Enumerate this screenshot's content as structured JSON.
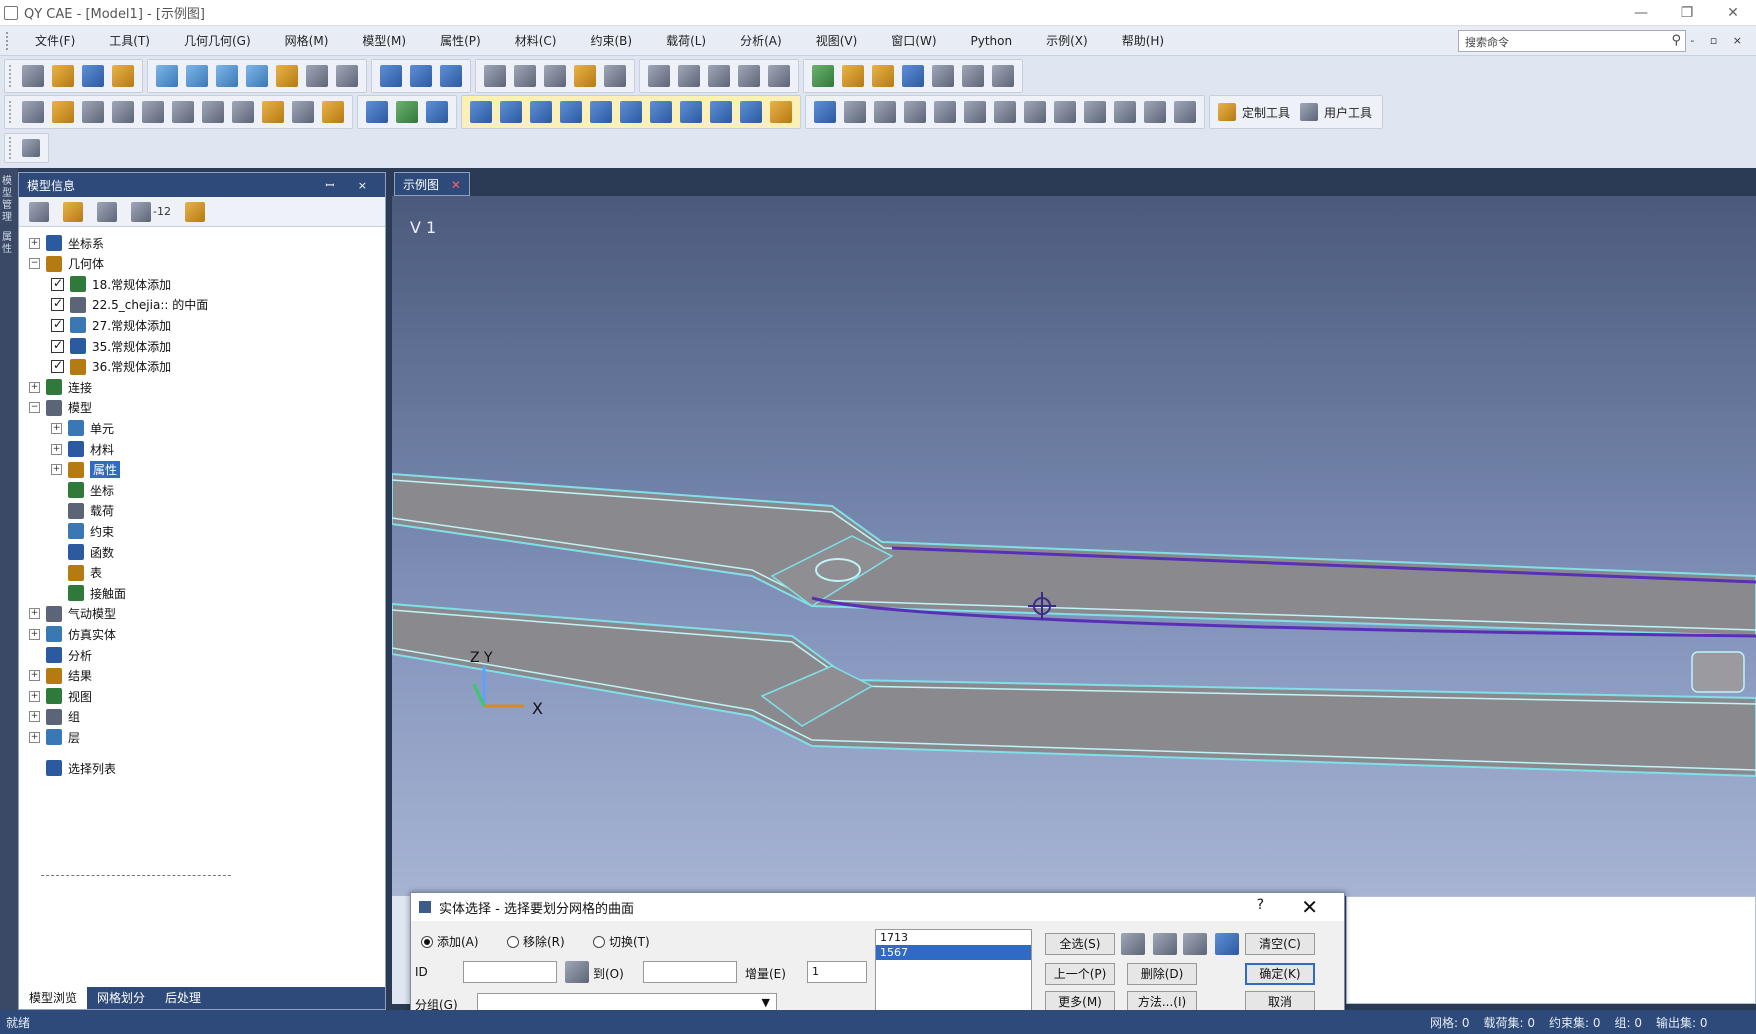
{
  "window": {
    "title": "QY CAE - [Model1] - [示例图]",
    "controls": [
      "—",
      "❐",
      "✕"
    ]
  },
  "menubar": {
    "items": [
      "文件(F)",
      "工具(T)",
      "几何几何(G)",
      "网格(M)",
      "模型(M)",
      "属性(P)",
      "材料(C)",
      "约束(B)",
      "载荷(L)",
      "分析(A)",
      "视图(V)",
      "窗口(W)",
      "Python",
      "示例(X)",
      "帮助(H)"
    ],
    "search_placeholder": "搜索命令",
    "small_controls": "- ▫ ×"
  },
  "toolbars": {
    "custom_tools_label": "定制工具",
    "user_tools_label": "用户工具"
  },
  "left_strip": {
    "labels": [
      "模型管理",
      "属性"
    ]
  },
  "model_panel": {
    "title": "模型信息",
    "header_controls": "ꟷ ×",
    "count_label": "-12",
    "tree": [
      {
        "label": "坐标系",
        "level": 0,
        "expander": "+",
        "icon": "axis-icon"
      },
      {
        "label": "几何体",
        "level": 0,
        "expander": "−",
        "icon": "geometry-icon"
      },
      {
        "label": "18.常规体添加",
        "level": 1,
        "checked": true,
        "icon": "part-icon"
      },
      {
        "label": "22.5_chejia:: 的中面",
        "level": 1,
        "checked": true,
        "icon": "part-icon"
      },
      {
        "label": "27.常规体添加",
        "level": 1,
        "checked": true,
        "icon": "part-icon"
      },
      {
        "label": "35.常规体添加",
        "level": 1,
        "checked": true,
        "icon": "part-icon"
      },
      {
        "label": "36.常规体添加",
        "level": 1,
        "checked": true,
        "icon": "part-icon"
      },
      {
        "label": "连接",
        "level": 0,
        "expander": "+",
        "icon": "connection-icon"
      },
      {
        "label": "模型",
        "level": 0,
        "expander": "−",
        "icon": "model-icon"
      },
      {
        "label": "单元",
        "level": 1,
        "expander": "+",
        "icon": "element-icon"
      },
      {
        "label": "材料",
        "level": 1,
        "expander": "+",
        "icon": "material-icon"
      },
      {
        "label": "属性",
        "level": 1,
        "expander": "+",
        "icon": "property-icon",
        "selected": true
      },
      {
        "label": "坐标",
        "level": 1,
        "icon": "coord-icon"
      },
      {
        "label": "载荷",
        "level": 1,
        "icon": "load-icon"
      },
      {
        "label": "约束",
        "level": 1,
        "icon": "constraint-icon"
      },
      {
        "label": "函数",
        "level": 1,
        "icon": "function-icon"
      },
      {
        "label": "表",
        "level": 1,
        "icon": "table-icon"
      },
      {
        "label": "接触面",
        "level": 1,
        "icon": "contact-icon"
      },
      {
        "label": "气动模型",
        "level": 0,
        "expander": "+",
        "icon": "aero-icon"
      },
      {
        "label": "仿真实体",
        "level": 0,
        "expander": "+",
        "icon": "sim-icon"
      },
      {
        "label": "分析",
        "level": 0,
        "icon": "analysis-icon"
      },
      {
        "label": "结果",
        "level": 0,
        "expander": "+",
        "icon": "result-icon"
      },
      {
        "label": "视图",
        "level": 0,
        "expander": "+",
        "icon": "view-icon"
      },
      {
        "label": "组",
        "level": 0,
        "expander": "+",
        "icon": "group-icon"
      },
      {
        "label": "层",
        "level": 0,
        "expander": "+",
        "icon": "layer-icon"
      },
      {
        "label": "选择列表",
        "level": 0,
        "icon": "selection-icon"
      }
    ],
    "tabs": [
      "模型浏览",
      "网格划分",
      "后处理"
    ]
  },
  "viewport": {
    "tab_label": "示例图",
    "view_label": "V 1",
    "axis_labels": {
      "z": "Z",
      "y": "Y",
      "x": "X"
    }
  },
  "dialog": {
    "title": "实体选择 - 选择要划分网格的曲面",
    "help": "?",
    "close": "✕",
    "modes": [
      {
        "label": "添加(A)",
        "selected": true
      },
      {
        "label": "移除(R)",
        "selected": false
      },
      {
        "label": "切换(T)",
        "selected": false
      }
    ],
    "id_label": "ID",
    "to_label": "到(O)",
    "increment_label": "增量(E)",
    "increment_value": "1",
    "group_label": "分组(G)",
    "list_items": [
      "1713",
      "1567"
    ],
    "selected_list_index": 1,
    "buttons": {
      "select_all": "全选(S)",
      "clear": "清空(C)",
      "prev": "上一个(P)",
      "delete": "删除(D)",
      "confirm": "确定(K)",
      "more": "更多(M)",
      "method": "方法...(I)",
      "cancel": "取消"
    }
  },
  "statusbar": {
    "left": "就绪",
    "right": [
      "网格: 0",
      "载荷集: 0",
      "约束集: 0",
      "组: 0",
      "输出集: 0"
    ]
  }
}
